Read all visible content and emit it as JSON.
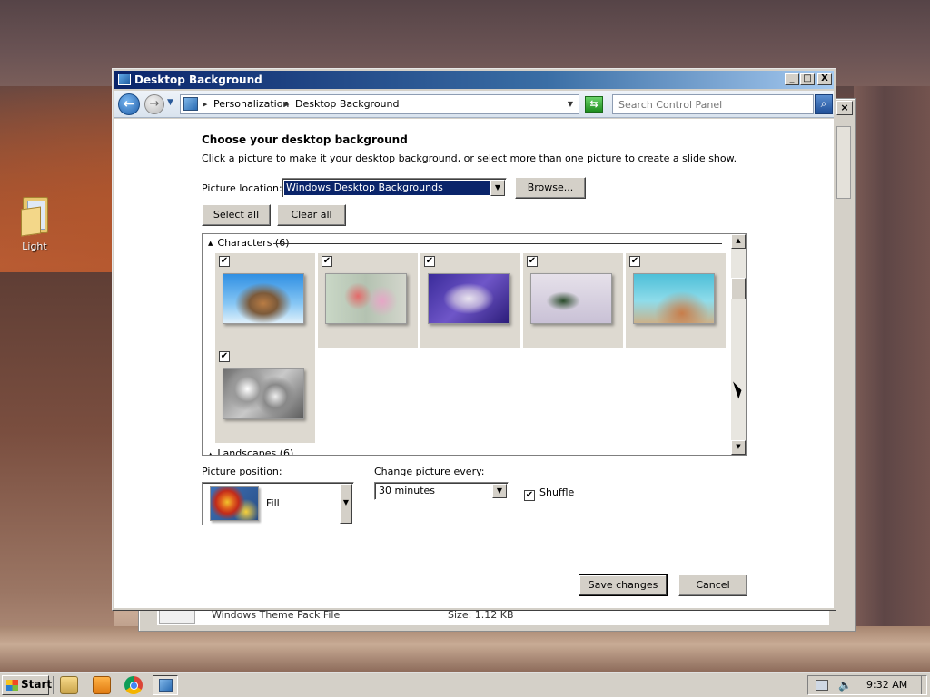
{
  "desktop": {
    "icons": [
      {
        "label": "Light"
      }
    ]
  },
  "background_window": {
    "file_name": "Windows Theme Pack File",
    "file_size": "Size: 1.12 KB"
  },
  "window": {
    "title": "Desktop Background",
    "controls": {
      "minimize": "_",
      "maximize": "□",
      "close": "X"
    }
  },
  "navigation": {
    "breadcrumbs": [
      "Personalization",
      "Desktop Background"
    ],
    "search_placeholder": "Search Control Panel"
  },
  "content": {
    "heading": "Choose your desktop background",
    "description": "Click a picture to make it your desktop background, or select more than one picture to create a slide show.",
    "picture_location_label": "Picture location:",
    "picture_location_value": "Windows Desktop Backgrounds",
    "browse_label": "Browse...",
    "select_all_label": "Select all",
    "clear_all_label": "Clear all",
    "groups": [
      {
        "title": "Characters (6)",
        "expanded": true
      },
      {
        "title": "Landscapes (6)",
        "expanded": true
      }
    ],
    "tiles": [
      {
        "checked": true,
        "check_glyph": "✔"
      },
      {
        "checked": true,
        "check_glyph": "✔"
      },
      {
        "checked": true,
        "check_glyph": "✔"
      },
      {
        "checked": true,
        "check_glyph": "✔"
      },
      {
        "checked": true,
        "check_glyph": "✔"
      },
      {
        "checked": true,
        "check_glyph": "✔"
      }
    ],
    "picture_position_label": "Picture position:",
    "picture_position_value": "Fill",
    "change_picture_label": "Change picture every:",
    "change_picture_value": "30 minutes",
    "shuffle_label": "Shuffle",
    "shuffle_checked": true,
    "save_label": "Save changes",
    "cancel_label": "Cancel"
  },
  "taskbar": {
    "start_label": "Start",
    "clock": "9:32 AM"
  }
}
